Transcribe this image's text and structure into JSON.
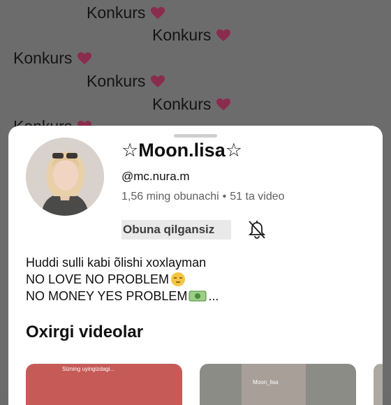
{
  "background": {
    "lines": [
      "Konkurs",
      "Konkurs",
      "Konkurs",
      "Konkurs",
      "Konkurs",
      "Konkurs"
    ]
  },
  "channel": {
    "name": "☆Moon.lisa☆",
    "handle": "@mc.nura.m",
    "subscribers": "1,56 ming obunachi",
    "separator": "•",
    "videos": "51 ta video",
    "subscribe_label": "Obuna qilgansiz",
    "description": [
      "Huddi sulli kabi õlishi xoxlayman",
      "NO LOVE NO PROBLEM",
      "NO MONEY YES PROBLEM",
      "..."
    ]
  },
  "recent": {
    "title": "Oxirgi videolar",
    "thumb_captions": [
      "Sizning uyingizdagi...",
      "Moon_lisa"
    ]
  },
  "colors": {
    "background_dim": "#6b6b6b",
    "heart": "#e0457b",
    "sheet": "#ffffff",
    "button_bg": "#e9e9e9"
  },
  "icons": [
    "heart-icon",
    "bell-off-icon",
    "unamused-face-emoji",
    "money-emoji"
  ]
}
